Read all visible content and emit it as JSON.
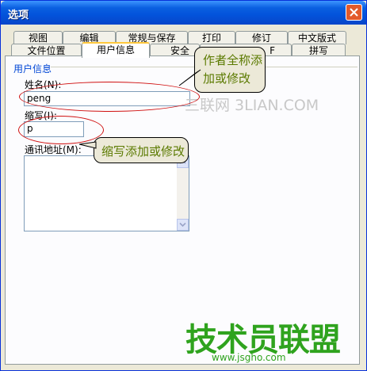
{
  "window": {
    "title": "选项"
  },
  "tabs_row1": [
    "视图",
    "编辑",
    "常规与保存",
    "打印",
    "修订",
    "中文版式"
  ],
  "tabs_row2": [
    "文件位置",
    "用户信息",
    "安全",
    "F",
    "拼写"
  ],
  "user_info": {
    "group_title": "用户信息",
    "name_label": "姓名(N):",
    "name_value": "peng",
    "initials_label": "缩写(I):",
    "initials_value": "p",
    "address_label": "通讯地址(M):",
    "address_value": ""
  },
  "callouts": {
    "name_note_line1": "作者全称添",
    "name_note_line2": "加或修改",
    "initials_note": "缩写添加或修改"
  },
  "watermarks": {
    "site_text": "三联网 3LIAN.COM",
    "brand": "技术员联盟",
    "url": "www.jsgho.com"
  },
  "colors": {
    "title_bar": "#0A5FE0",
    "callout_text": "#5B7A00",
    "highlight": "#D01010",
    "brand": "#2FA31E"
  }
}
